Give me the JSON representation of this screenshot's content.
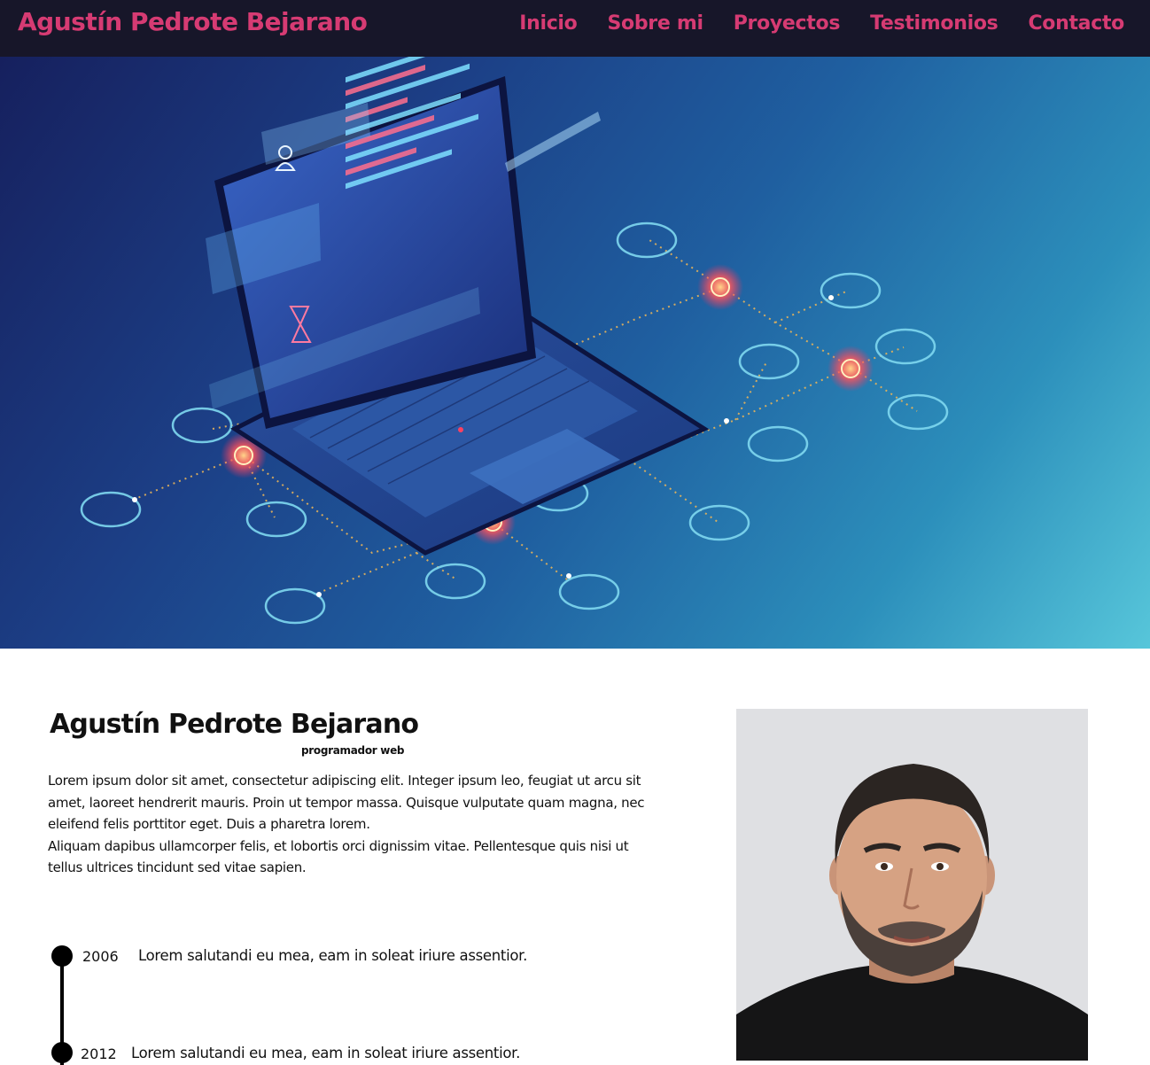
{
  "header": {
    "brand": "Agustín Pedrote Bejarano",
    "nav": [
      {
        "label": "Inicio"
      },
      {
        "label": "Sobre mi"
      },
      {
        "label": "Proyectos"
      },
      {
        "label": "Testimonios"
      },
      {
        "label": "Contacto"
      }
    ]
  },
  "about": {
    "name": "Agustín Pedrote Bejarano",
    "role": "programador web",
    "paragraphs": [
      "Lorem ipsum dolor sit amet, consectetur adipiscing elit. Integer ipsum leo, feugiat ut arcu sit amet, laoreet hendrerit mauris. Proin ut tempor massa. Quisque vulputate quam magna, nec eleifend felis porttitor eget. Duis a pharetra lorem.",
      "Aliquam dapibus ullamcorper felis, et lobortis orci dignissim vitae. Pellentesque quis nisi ut tellus ultrices tincidunt sed vitae sapien."
    ]
  },
  "timeline": [
    {
      "year": "2006",
      "text": "Lorem salutandi eu mea, eam in soleat iriure assentior."
    },
    {
      "year": "2012",
      "text": "Lorem salutandi eu mea, eam in soleat iriure assentior."
    }
  ],
  "colors": {
    "nav_background": "#171629",
    "accent": "#d63b73"
  }
}
